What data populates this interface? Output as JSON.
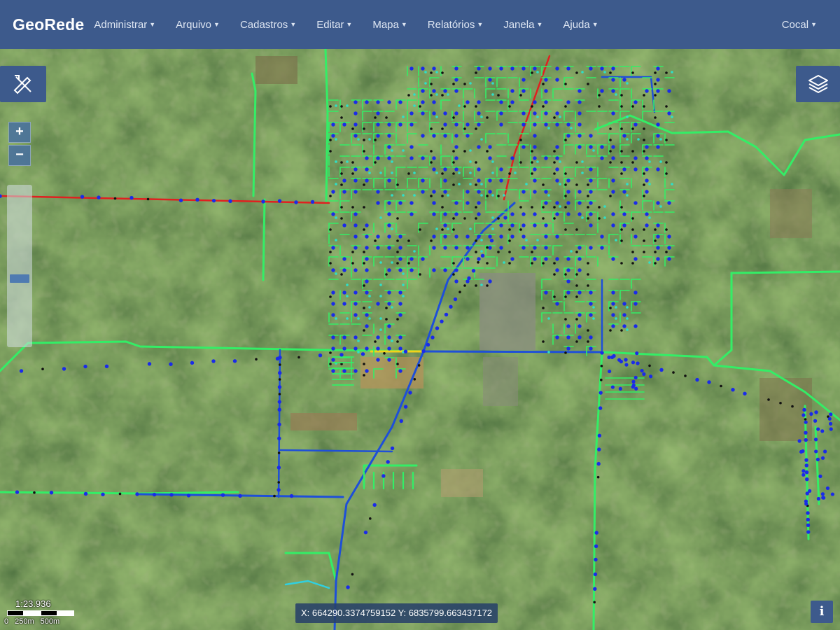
{
  "app": {
    "title": "GeoRede"
  },
  "menu": {
    "items": [
      {
        "label": "Administrar"
      },
      {
        "label": "Arquivo"
      },
      {
        "label": "Cadastros"
      },
      {
        "label": "Editar"
      },
      {
        "label": "Mapa"
      },
      {
        "label": "Relatórios"
      },
      {
        "label": "Janela"
      },
      {
        "label": "Ajuda"
      }
    ],
    "caret_icon": "chevron-down-icon",
    "user_label": "Cocal"
  },
  "map": {
    "controls": {
      "zoom_in_label": "+",
      "zoom_out_label": "−",
      "tools_icon": "drafting-tools-icon",
      "layers_icon": "layers-stack-icon",
      "info_label": "i"
    },
    "zoom_level_fraction": 0.58,
    "scale": {
      "ratio": "1:23.936",
      "ticks": [
        "0",
        "250m",
        "500m"
      ]
    },
    "coordinates": "X: 664290.3374759152 Y: 6835799.663437172",
    "network_colors": {
      "primary_line": "#33ee66",
      "secondary_line": "#1e4fd8",
      "trunk_line": "#e02020",
      "highlight_line": "#f2d21a",
      "water_line": "#30d0e0",
      "point_blue": "#1a2be8",
      "point_black": "#111111",
      "point_cyan": "#2ee0c8"
    }
  }
}
